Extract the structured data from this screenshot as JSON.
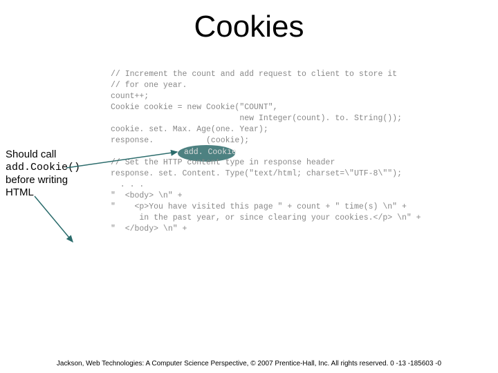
{
  "title": "Cookies",
  "callout": {
    "line1": "Should call",
    "line2_code": "add.Cookie()",
    "line3": "before writing",
    "line4": "HTML"
  },
  "code": {
    "l1": "// Increment the count and add request to client to store it",
    "l2": "// for one year.",
    "l3": "count++;",
    "l4": "Cookie cookie = new Cookie(\"COUNT\",",
    "l5": "                           new Integer(count). to. String());",
    "l6": "cookie. set. Max. Age(one. Year);",
    "l7": "response.           (cookie);",
    "l8": "",
    "l9": "// Set the HTTP content type in response header",
    "l10": "response. set. Content. Type(\"text/html; charset=\\\"UTF-8\\\"\");",
    "l11": "  . . .",
    "l12": "\"  <body> \\n\" +",
    "l13": "\"    <p>You have visited this page \" + count + \" time(s) \\n\" +",
    "l14": "      in the past year, or since clearing your cookies.</p> \\n\" +",
    "l15": "\"  </body> \\n\" +"
  },
  "highlight_text": "add. Cookie",
  "footer": "Jackson, Web Technologies: A Computer Science Perspective, © 2007 Prentice-Hall, Inc. All rights reserved. 0 -13 -185603 -0"
}
